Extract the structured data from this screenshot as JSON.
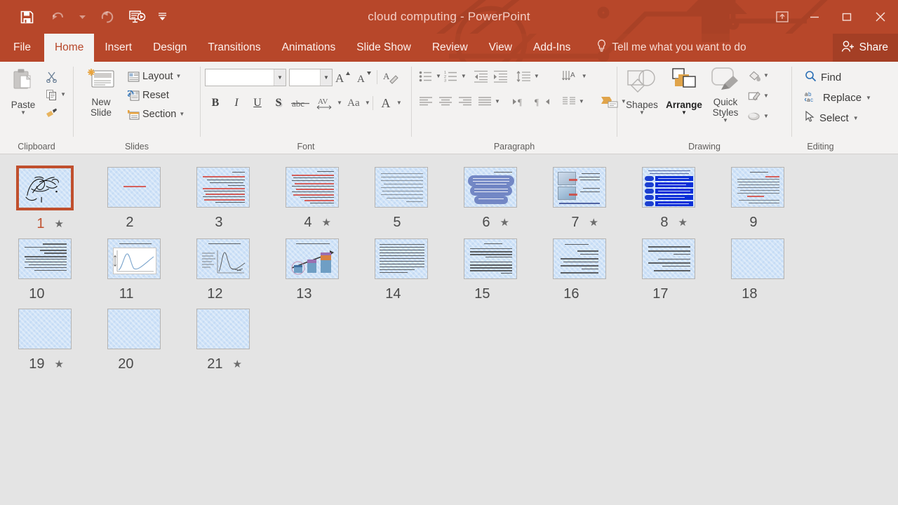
{
  "window": {
    "title": "cloud computing - PowerPoint",
    "accent_color": "#b7472a",
    "ribbon_bg": "#f3f2f1",
    "panel_bg": "#e4e4e4",
    "selection_color": "#c0502e"
  },
  "quick_access": {
    "items": [
      {
        "name": "save-icon",
        "label": "Save",
        "state": "enabled"
      },
      {
        "name": "undo-icon",
        "label": "Undo",
        "state": "disabled"
      },
      {
        "name": "undo-dropdown-icon",
        "label": "Undo options",
        "state": "disabled"
      },
      {
        "name": "redo-icon",
        "label": "Redo",
        "state": "disabled"
      },
      {
        "name": "start-slideshow-icon",
        "label": "Start From Beginning",
        "state": "enabled"
      },
      {
        "name": "customize-qat-icon",
        "label": "Customize Quick Access Toolbar",
        "state": "enabled"
      }
    ]
  },
  "window_controls": {
    "ribbon_display": "Ribbon Display Options",
    "minimize": "Minimize",
    "restore": "Restore Down",
    "close": "Close"
  },
  "tabs": [
    {
      "label": "File",
      "active": false
    },
    {
      "label": "Home",
      "active": true
    },
    {
      "label": "Insert",
      "active": false
    },
    {
      "label": "Design",
      "active": false
    },
    {
      "label": "Transitions",
      "active": false
    },
    {
      "label": "Animations",
      "active": false
    },
    {
      "label": "Slide Show",
      "active": false
    },
    {
      "label": "Review",
      "active": false
    },
    {
      "label": "View",
      "active": false
    },
    {
      "label": "Add-Ins",
      "active": false
    }
  ],
  "tell_me": {
    "label": "Tell me what you want to do",
    "icon": "lightbulb-icon"
  },
  "share": {
    "label": "Share",
    "icon": "share-person-icon"
  },
  "ribbon": {
    "groups": [
      {
        "name": "clipboard",
        "label": "Clipboard",
        "paste_label": "Paste",
        "items": [
          {
            "name": "cut-icon",
            "label": "Cut"
          },
          {
            "name": "copy-icon",
            "label": "Copy"
          },
          {
            "name": "format-painter-icon",
            "label": "Format Painter"
          }
        ]
      },
      {
        "name": "slides",
        "label": "Slides",
        "new_slide_label": "New Slide",
        "items": [
          {
            "name": "layout-button",
            "label": "Layout"
          },
          {
            "name": "reset-button",
            "label": "Reset"
          },
          {
            "name": "section-button",
            "label": "Section"
          }
        ]
      },
      {
        "name": "font",
        "label": "Font",
        "font_family_value": "",
        "font_family_placeholder": "",
        "font_size_value": "",
        "font_size_placeholder": "",
        "items": [
          {
            "name": "increase-font-size-button",
            "label": "A"
          },
          {
            "name": "decrease-font-size-button",
            "label": "A"
          },
          {
            "name": "clear-formatting-button",
            "label": "Clear All Formatting"
          },
          {
            "name": "bold-button",
            "label": "B"
          },
          {
            "name": "italic-button",
            "label": "I"
          },
          {
            "name": "underline-button",
            "label": "U"
          },
          {
            "name": "text-shadow-button",
            "label": "S"
          },
          {
            "name": "strikethrough-button",
            "label": "abc"
          },
          {
            "name": "character-spacing-button",
            "label": "AV"
          },
          {
            "name": "change-case-button",
            "label": "Aa"
          },
          {
            "name": "font-color-button",
            "label": "A"
          }
        ]
      },
      {
        "name": "paragraph",
        "label": "Paragraph",
        "items": [
          {
            "name": "bullets-button",
            "label": "Bullets"
          },
          {
            "name": "numbering-button",
            "label": "Numbering"
          },
          {
            "name": "decrease-indent-button",
            "label": "Decrease List Level"
          },
          {
            "name": "increase-indent-button",
            "label": "Increase List Level"
          },
          {
            "name": "line-spacing-button",
            "label": "Line Spacing"
          },
          {
            "name": "align-left-button",
            "label": "Align Left"
          },
          {
            "name": "align-center-button",
            "label": "Center"
          },
          {
            "name": "align-right-button",
            "label": "Align Right"
          },
          {
            "name": "justify-button",
            "label": "Justify"
          },
          {
            "name": "ltr-button",
            "label": "Left-to-Right"
          },
          {
            "name": "rtl-button",
            "label": "Right-to-Left"
          },
          {
            "name": "columns-button",
            "label": "Columns"
          },
          {
            "name": "text-direction-button",
            "label": "Text Direction"
          },
          {
            "name": "align-text-button",
            "label": "Align Text"
          },
          {
            "name": "convert-to-smartart-button",
            "label": "Convert to SmartArt"
          }
        ]
      },
      {
        "name": "drawing",
        "label": "Drawing",
        "shapes_label": "Shapes",
        "arrange_label": "Arrange",
        "quick_styles_label": "Quick Styles",
        "items": [
          {
            "name": "shape-fill-button",
            "label": "Shape Fill"
          },
          {
            "name": "shape-outline-button",
            "label": "Shape Outline"
          },
          {
            "name": "shape-effects-button",
            "label": "Shape Effects"
          }
        ]
      },
      {
        "name": "editing",
        "label": "Editing",
        "items": [
          {
            "name": "find-button",
            "label": "Find",
            "icon": "magnifier-icon"
          },
          {
            "name": "replace-button",
            "label": "Replace",
            "icon": "ab-ac-icon"
          },
          {
            "name": "select-button",
            "label": "Select",
            "icon": "cursor-arrow-icon"
          }
        ]
      }
    ]
  },
  "slides_panel": {
    "rows": [
      [
        {
          "number": "1",
          "star": "★",
          "selected": true,
          "art": "calligraphy"
        },
        {
          "number": "2",
          "star": "",
          "selected": false,
          "art": "title-red"
        },
        {
          "number": "3",
          "star": "",
          "selected": false,
          "art": "text-red"
        },
        {
          "number": "4",
          "star": "★",
          "selected": false,
          "art": "text-red-dense"
        },
        {
          "number": "5",
          "star": "",
          "selected": false,
          "art": "text-plain"
        },
        {
          "number": "6",
          "star": "★",
          "selected": false,
          "art": "clouds"
        },
        {
          "number": "7",
          "star": "★",
          "selected": false,
          "art": "images"
        },
        {
          "number": "8",
          "star": "★",
          "selected": false,
          "art": "blue-table"
        },
        {
          "number": "9",
          "star": "",
          "selected": false,
          "art": "text-red-light"
        }
      ],
      [
        {
          "number": "10",
          "star": "",
          "selected": false,
          "art": "text-dark"
        },
        {
          "number": "11",
          "star": "",
          "selected": false,
          "art": "line-chart"
        },
        {
          "number": "12",
          "star": "",
          "selected": false,
          "art": "line-chart-2"
        },
        {
          "number": "13",
          "star": "",
          "selected": false,
          "art": "bar-chart"
        },
        {
          "number": "14",
          "star": "",
          "selected": false,
          "art": "text-dense"
        },
        {
          "number": "15",
          "star": "",
          "selected": false,
          "art": "text-bold"
        },
        {
          "number": "16",
          "star": "",
          "selected": false,
          "art": "text-spaced"
        },
        {
          "number": "17",
          "star": "",
          "selected": false,
          "art": "text-short"
        },
        {
          "number": "18",
          "star": "",
          "selected": false,
          "art": "blank"
        }
      ],
      [
        {
          "number": "19",
          "star": "★",
          "selected": false,
          "art": "blank"
        },
        {
          "number": "20",
          "star": "",
          "selected": false,
          "art": "blank"
        },
        {
          "number": "21",
          "star": "★",
          "selected": false,
          "art": "blank"
        }
      ]
    ]
  }
}
